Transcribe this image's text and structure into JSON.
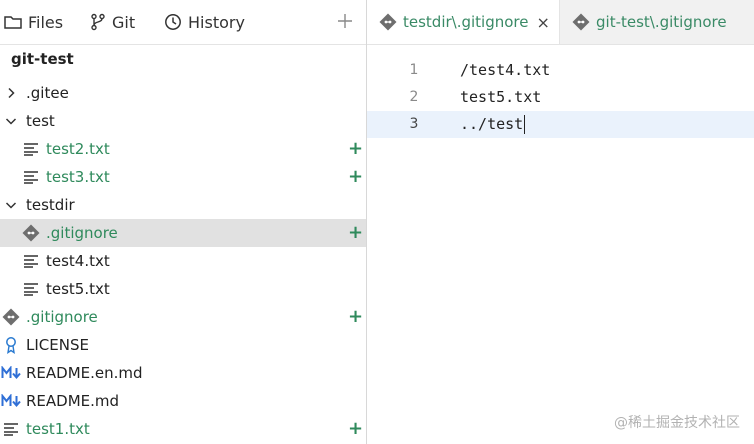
{
  "left_tabs": {
    "files": "Files",
    "git": "Git",
    "history": "History"
  },
  "project_name": "git-test",
  "tree": [
    {
      "label": "gitee_folder",
      "text": ".gitee",
      "type": "folder",
      "expanded": false,
      "level": 0,
      "added": false
    },
    {
      "label": "test_folder",
      "text": "test",
      "type": "folder",
      "expanded": true,
      "level": 0,
      "added": false
    },
    {
      "text": "test2.txt",
      "type": "text",
      "level": 1,
      "added": true
    },
    {
      "text": "test3.txt",
      "type": "text",
      "level": 1,
      "added": true
    },
    {
      "text": "testdir",
      "type": "folder",
      "expanded": true,
      "level": 0,
      "added": false
    },
    {
      "text": ".gitignore",
      "type": "git",
      "level": 1,
      "added": true,
      "selected": true
    },
    {
      "text": "test4.txt",
      "type": "text",
      "level": 1,
      "added": false
    },
    {
      "text": "test5.txt",
      "type": "text",
      "level": 1,
      "added": false
    },
    {
      "text": ".gitignore",
      "type": "git",
      "level": 0,
      "added": true
    },
    {
      "text": "LICENSE",
      "type": "license",
      "level": 0,
      "added": false
    },
    {
      "text": "README.en.md",
      "type": "markdown",
      "level": 0,
      "added": false
    },
    {
      "text": "README.md",
      "type": "markdown",
      "level": 0,
      "added": false
    },
    {
      "text": "test1.txt",
      "type": "text",
      "level": 0,
      "added": true
    }
  ],
  "editor_tabs": [
    {
      "text": "testdir\\.gitignore",
      "active": true,
      "close": "×"
    },
    {
      "text": "git-test\\.gitignore",
      "active": false
    }
  ],
  "editor_lines": [
    {
      "num": "1",
      "text": "/test4.txt"
    },
    {
      "num": "2",
      "text": "test5.txt"
    },
    {
      "num": "3",
      "text": "../test"
    }
  ],
  "added_marker": "+",
  "watermark": "@稀土掘金技术社区",
  "colors": {
    "added_green": "#2f8a5c",
    "selected_row": "#e1e1e1",
    "current_line": "#eaf2fc",
    "markdown_blue": "#2f6fd6"
  }
}
